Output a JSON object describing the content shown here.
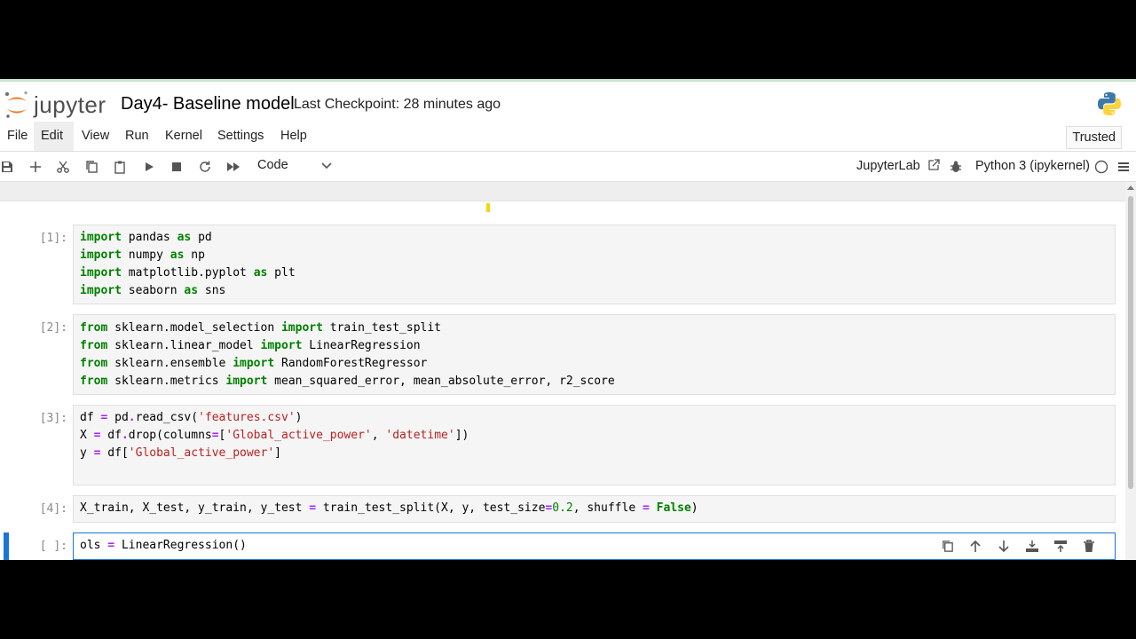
{
  "header": {
    "logo_text": "jupyter",
    "notebook_title": "Day4- Baseline model",
    "checkpoint": "Last Checkpoint: 28 minutes ago"
  },
  "menu": {
    "items": [
      "File",
      "Edit",
      "View",
      "Run",
      "Kernel",
      "Settings",
      "Help"
    ],
    "active": "Edit",
    "trusted": "Trusted"
  },
  "toolbar": {
    "cell_type": "Code",
    "jupyterlab_label": "JupyterLab",
    "kernel_name": "Python 3 (ipykernel)"
  },
  "cells": [
    {
      "prompt": "[1]:",
      "lines": [
        [
          {
            "t": "import",
            "c": "kw"
          },
          {
            "t": " pandas "
          },
          {
            "t": "as",
            "c": "kw"
          },
          {
            "t": " pd"
          }
        ],
        [
          {
            "t": "import",
            "c": "kw"
          },
          {
            "t": " numpy "
          },
          {
            "t": "as",
            "c": "kw"
          },
          {
            "t": " np"
          }
        ],
        [
          {
            "t": "import",
            "c": "kw"
          },
          {
            "t": " matplotlib.pyplot "
          },
          {
            "t": "as",
            "c": "kw"
          },
          {
            "t": " plt"
          }
        ],
        [
          {
            "t": "import",
            "c": "kw"
          },
          {
            "t": " seaborn "
          },
          {
            "t": "as",
            "c": "kw"
          },
          {
            "t": " sns"
          }
        ]
      ]
    },
    {
      "prompt": "[2]:",
      "lines": [
        [
          {
            "t": "from",
            "c": "kw"
          },
          {
            "t": " sklearn.model_selection "
          },
          {
            "t": "import",
            "c": "kw"
          },
          {
            "t": " train_test_split"
          }
        ],
        [
          {
            "t": "from",
            "c": "kw"
          },
          {
            "t": " sklearn.linear_model "
          },
          {
            "t": "import",
            "c": "kw"
          },
          {
            "t": " LinearRegression"
          }
        ],
        [
          {
            "t": "from",
            "c": "kw"
          },
          {
            "t": " sklearn.ensemble "
          },
          {
            "t": "import",
            "c": "kw"
          },
          {
            "t": " RandomForestRegressor"
          }
        ],
        [
          {
            "t": "from",
            "c": "kw"
          },
          {
            "t": " sklearn.metrics "
          },
          {
            "t": "import",
            "c": "kw"
          },
          {
            "t": " mean_squared_error, mean_absolute_error, r2_score"
          }
        ]
      ]
    },
    {
      "prompt": "[3]:",
      "lines": [
        [
          {
            "t": "df "
          },
          {
            "t": "=",
            "c": "op"
          },
          {
            "t": " pd"
          },
          {
            "t": ".",
            "c": "op"
          },
          {
            "t": "read_csv("
          },
          {
            "t": "'features.csv'",
            "c": "str"
          },
          {
            "t": ")"
          }
        ],
        [
          {
            "t": "X "
          },
          {
            "t": "=",
            "c": "op"
          },
          {
            "t": " df"
          },
          {
            "t": ".",
            "c": "op"
          },
          {
            "t": "drop(columns"
          },
          {
            "t": "=",
            "c": "op"
          },
          {
            "t": "["
          },
          {
            "t": "'Global_active_power'",
            "c": "str"
          },
          {
            "t": ", "
          },
          {
            "t": "'datetime'",
            "c": "str"
          },
          {
            "t": "])"
          }
        ],
        [
          {
            "t": "y "
          },
          {
            "t": "=",
            "c": "op"
          },
          {
            "t": " df["
          },
          {
            "t": "'Global_active_power'",
            "c": "str"
          },
          {
            "t": "]"
          }
        ],
        []
      ]
    },
    {
      "prompt": "[4]:",
      "lines": [
        [
          {
            "t": "X_train, X_test, y_train, y_test "
          },
          {
            "t": "=",
            "c": "op"
          },
          {
            "t": " train_test_split(X, y, test_size"
          },
          {
            "t": "=",
            "c": "op"
          },
          {
            "t": "0.2",
            "c": "num"
          },
          {
            "t": ", shuffle "
          },
          {
            "t": "=",
            "c": "op"
          },
          {
            "t": " "
          },
          {
            "t": "False",
            "c": "kw"
          },
          {
            "t": ")"
          }
        ]
      ]
    },
    {
      "prompt": "[ ]:",
      "active": true,
      "lines": [
        [
          {
            "t": "ols "
          },
          {
            "t": "=",
            "c": "op"
          },
          {
            "t": " LinearRegression()"
          }
        ]
      ]
    }
  ]
}
